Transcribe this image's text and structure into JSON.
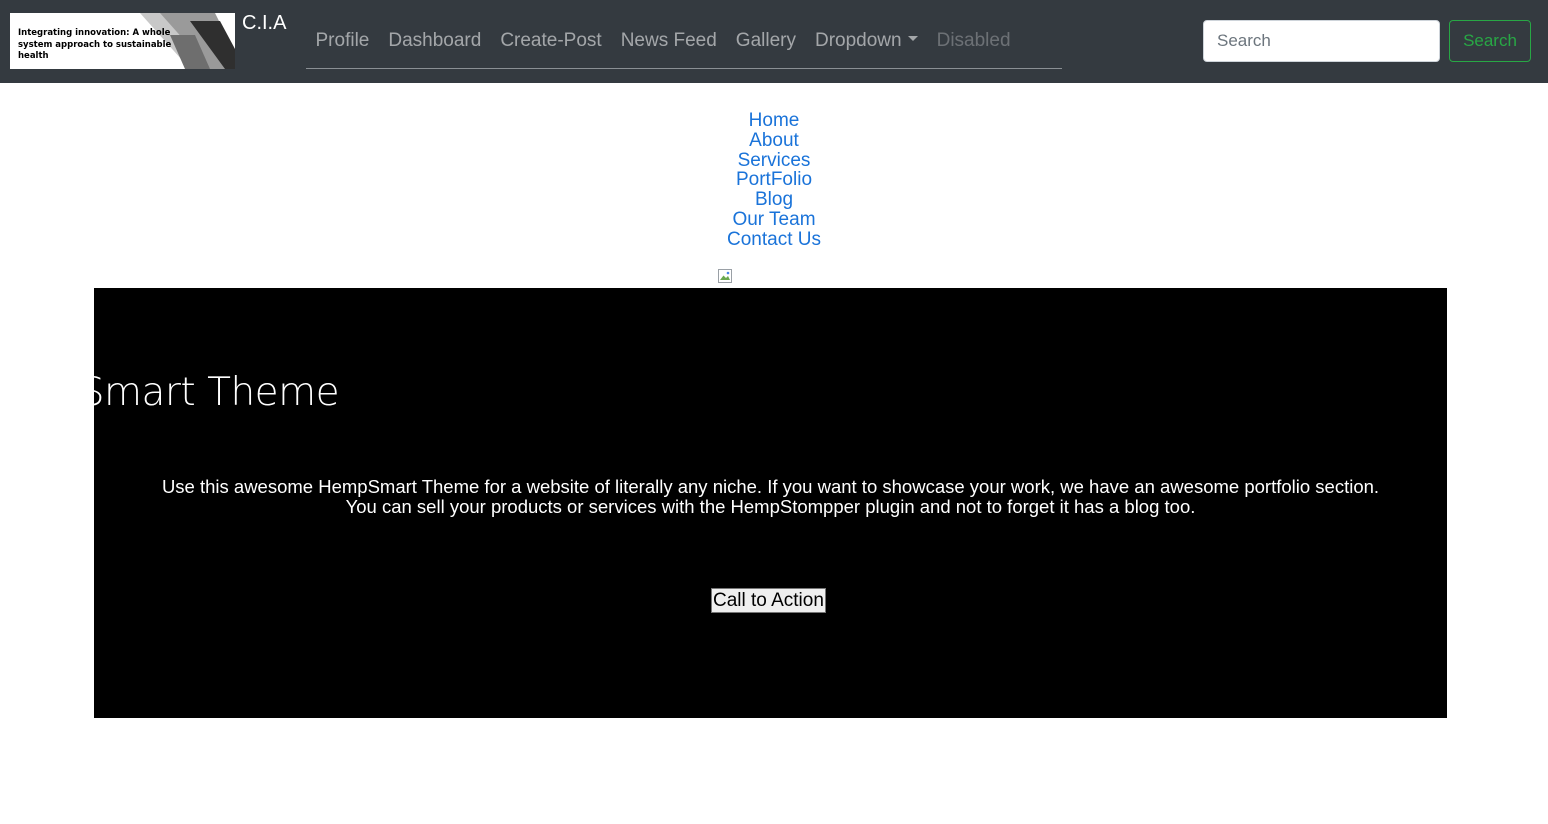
{
  "navbar": {
    "logo_text": "Integrating innovation: A whole system approach to sustainable health",
    "brand": "C.I.A",
    "links": [
      "Profile",
      "Dashboard",
      "Create-Post",
      "News Feed",
      "Gallery"
    ],
    "dropdown_label": "Dropdown",
    "disabled_label": "Disabled",
    "search": {
      "placeholder": "Search",
      "button_label": "Search"
    }
  },
  "menu": {
    "items": [
      "Home",
      "About",
      "Services",
      "PortFolio",
      "Blog",
      "Our Team",
      "Contact Us"
    ]
  },
  "hero": {
    "title": "mpSmart Theme",
    "text": "Use this awesome HempSmart Theme for a website of literally any niche. If you want to showcase your work, we have an awesome portfolio section. You can sell your products or services with the HempStompper plugin and not to forget it has a blog too.",
    "cta_label": "Call to Action"
  },
  "colors": {
    "navbar_bg": "#343a40",
    "link_blue": "#1a73d9",
    "search_green": "#28a745",
    "hero_bg": "#000000"
  },
  "icons": {
    "broken_image": "broken-image-icon",
    "dropdown_caret": "caret-down-icon"
  }
}
